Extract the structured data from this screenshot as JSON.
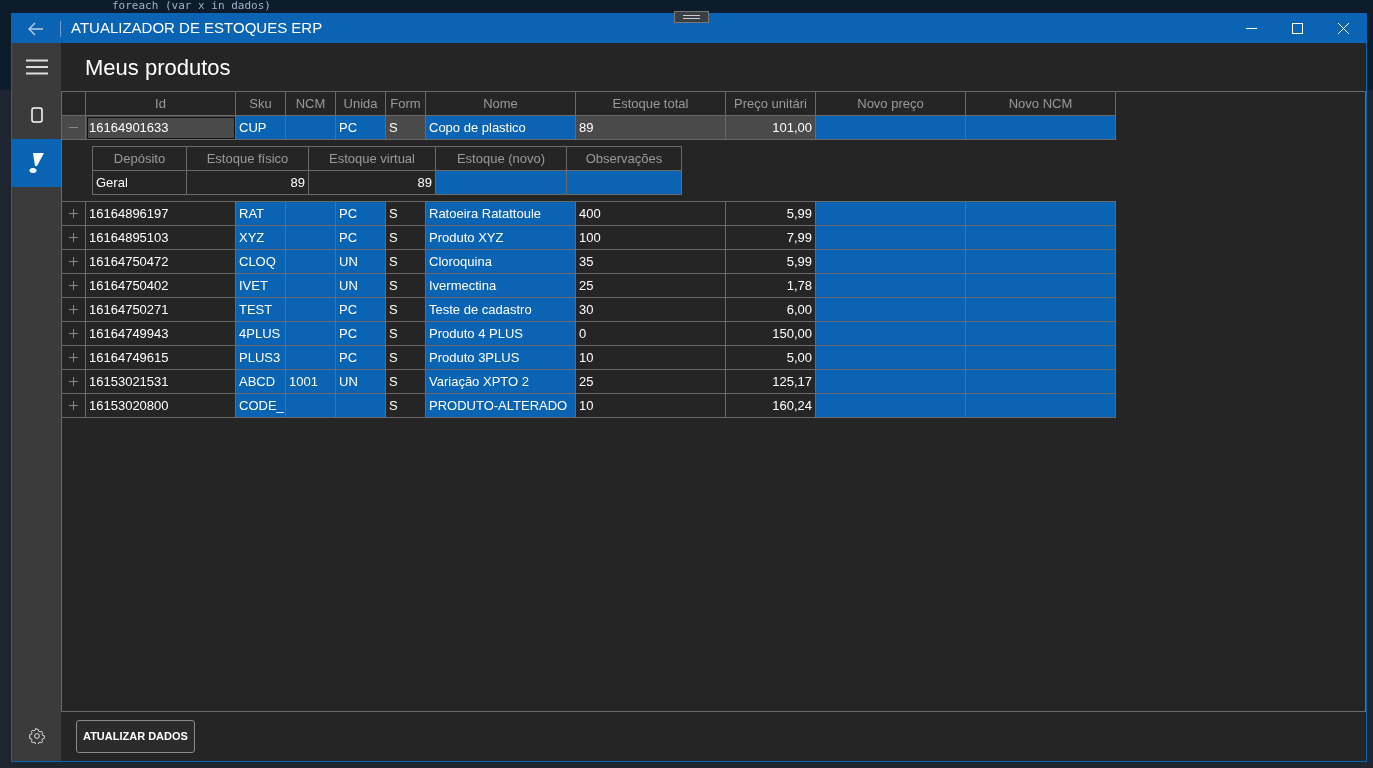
{
  "background_code": "foreach (var x in dados)",
  "window": {
    "title": "ATUALIZADOR DE ESTOQUES ERP"
  },
  "sidebar": {
    "items": [
      {
        "kind": "device",
        "selected": false
      },
      {
        "kind": "edit",
        "selected": true
      }
    ]
  },
  "page_title": "Meus produtos",
  "table": {
    "columns": [
      {
        "label": "Id",
        "editable": false,
        "kind": "text"
      },
      {
        "label": "Sku",
        "editable": true,
        "kind": "text"
      },
      {
        "label": "NCM",
        "editable": true,
        "kind": "text"
      },
      {
        "label": "Unida",
        "editable": true,
        "kind": "text"
      },
      {
        "label": "Form",
        "editable": false,
        "kind": "text"
      },
      {
        "label": "Nome",
        "editable": true,
        "kind": "text"
      },
      {
        "label": "Estoque total",
        "editable": false,
        "kind": "text"
      },
      {
        "label": "Preço unitári",
        "editable": false,
        "kind": "number"
      },
      {
        "label": "Novo preço",
        "editable": true,
        "kind": "text"
      },
      {
        "label": "Novo NCM",
        "editable": true,
        "kind": "text"
      }
    ],
    "rows": [
      {
        "expanded": true,
        "selected": true,
        "cells": [
          "16164901633",
          "CUP",
          null,
          "PC",
          "S",
          "Copo de plastico",
          "89",
          "101,00",
          null,
          null
        ],
        "details": {
          "columns": [
            {
              "label": "Depósito",
              "editable": false,
              "kind": "text"
            },
            {
              "label": "Estoque físico",
              "editable": false,
              "kind": "number"
            },
            {
              "label": "Estoque virtual",
              "editable": false,
              "kind": "number"
            },
            {
              "label": "Estoque (novo)",
              "editable": true,
              "kind": "text"
            },
            {
              "label": "Observações",
              "editable": true,
              "kind": "text"
            }
          ],
          "rows": [
            [
              "Geral",
              "89",
              "89",
              null,
              null
            ]
          ]
        }
      },
      {
        "expanded": false,
        "selected": false,
        "cells": [
          "16164896197",
          "RAT",
          null,
          "PC",
          "S",
          "Ratoeira Ratattoule",
          "400",
          "5,99",
          null,
          null
        ]
      },
      {
        "expanded": false,
        "selected": false,
        "cells": [
          "16164895103",
          "XYZ",
          null,
          "PC",
          "S",
          "Produto XYZ",
          "100",
          "7,99",
          null,
          null
        ]
      },
      {
        "expanded": false,
        "selected": false,
        "cells": [
          "16164750472",
          "CLOQ",
          null,
          "UN",
          "S",
          "Cloroquina",
          "35",
          "5,99",
          null,
          null
        ]
      },
      {
        "expanded": false,
        "selected": false,
        "cells": [
          "16164750402",
          "IVET",
          null,
          "UN",
          "S",
          "Ivermectina",
          "25",
          "1,78",
          null,
          null
        ]
      },
      {
        "expanded": false,
        "selected": false,
        "cells": [
          "16164750271",
          "TEST",
          null,
          "PC",
          "S",
          "Teste de cadastro",
          "30",
          "6,00",
          null,
          null
        ]
      },
      {
        "expanded": false,
        "selected": false,
        "cells": [
          "16164749943",
          "4PLUS",
          null,
          "PC",
          "S",
          "Produto 4 PLUS",
          "0",
          "150,00",
          null,
          null
        ]
      },
      {
        "expanded": false,
        "selected": false,
        "cells": [
          "16164749615",
          "PLUS3",
          null,
          "PC",
          "S",
          "Produto 3PLUS",
          "10",
          "5,00",
          null,
          null
        ]
      },
      {
        "expanded": false,
        "selected": false,
        "cells": [
          "16153021531",
          "ABCD",
          "1001",
          "UN",
          "S",
          "Variação XPTO 2",
          "25",
          "125,17",
          null,
          null
        ]
      },
      {
        "expanded": false,
        "selected": false,
        "cells": [
          "16153020800",
          "CODE_",
          null,
          null,
          "S",
          "PRODUTO-ALTERADO",
          "10",
          "160,24",
          null,
          null
        ]
      }
    ]
  },
  "footer": {
    "button": "ATUALIZAR DADOS"
  }
}
